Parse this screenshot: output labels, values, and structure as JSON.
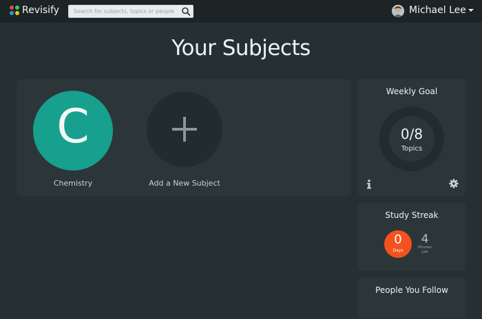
{
  "nav": {
    "brand": "Revisify",
    "search_placeholder": "Search for subjects, topics or people",
    "user_name": "Michael Lee"
  },
  "page": {
    "title": "Your Subjects"
  },
  "subjects": [
    {
      "letter": "C",
      "name": "Chemistry",
      "color": "#17a08d"
    }
  ],
  "add_subject": {
    "label": "Add a New Subject"
  },
  "weekly_goal": {
    "title": "Weekly Goal",
    "progress": "0/8",
    "unit": "Topics"
  },
  "study_streak": {
    "title": "Study Streak",
    "days_value": "0",
    "days_label": "Days",
    "minutes_value": "4",
    "minutes_label_line1": "Minutes",
    "minutes_label_line2": "Left"
  },
  "people_follow": {
    "title": "People You Follow"
  },
  "colors": {
    "background": "#263034",
    "navbar": "#1c2426",
    "panel": "#2c3639",
    "accent_teal": "#17a08d",
    "accent_orange": "#f4511e"
  },
  "icons": {
    "logo": "revisify-dots-logo",
    "search": "magnifier-icon",
    "user_menu": "caret-down-icon",
    "info": "info-icon",
    "settings": "gear-icon"
  }
}
